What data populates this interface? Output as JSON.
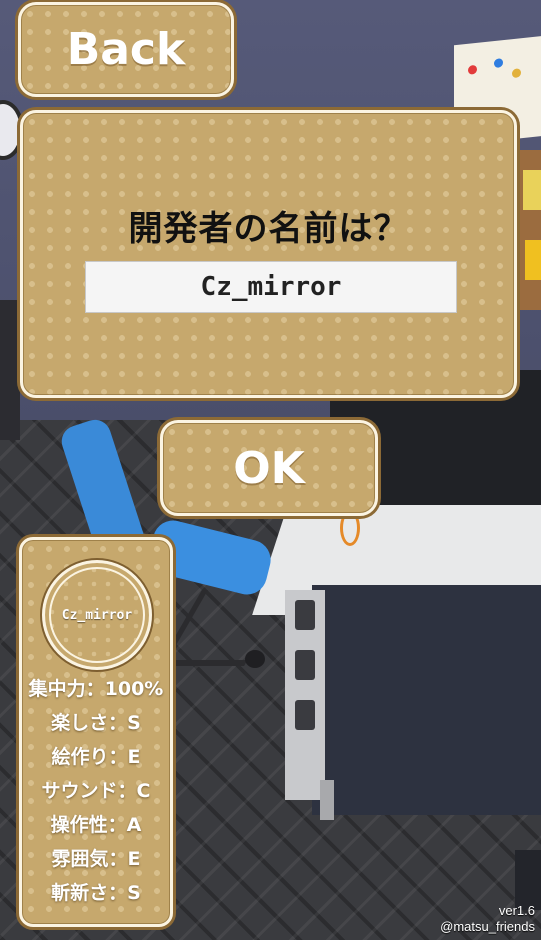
{
  "back_button": {
    "label": "Back"
  },
  "dialog": {
    "title": "開発者の名前は？",
    "input_value": "Cz_mirror"
  },
  "ok_button": {
    "label": "OK"
  },
  "profile": {
    "name": "Cz_mirror",
    "stats": [
      {
        "text": "集中力：100%"
      },
      {
        "text": "楽しさ：S"
      },
      {
        "text": "絵作り：E"
      },
      {
        "text": "サウンド：C"
      },
      {
        "text": "操作性：A"
      },
      {
        "text": "雰囲気：E"
      },
      {
        "text": "斬新さ：S"
      }
    ]
  },
  "footer": {
    "version": "ver1.6",
    "credit": "@matsu_friends"
  },
  "colors": {
    "panel": "#c6a86d",
    "panel_border": "#fbf4e2",
    "chair": "#3b8fe0",
    "wall": "#4a4e6a"
  }
}
